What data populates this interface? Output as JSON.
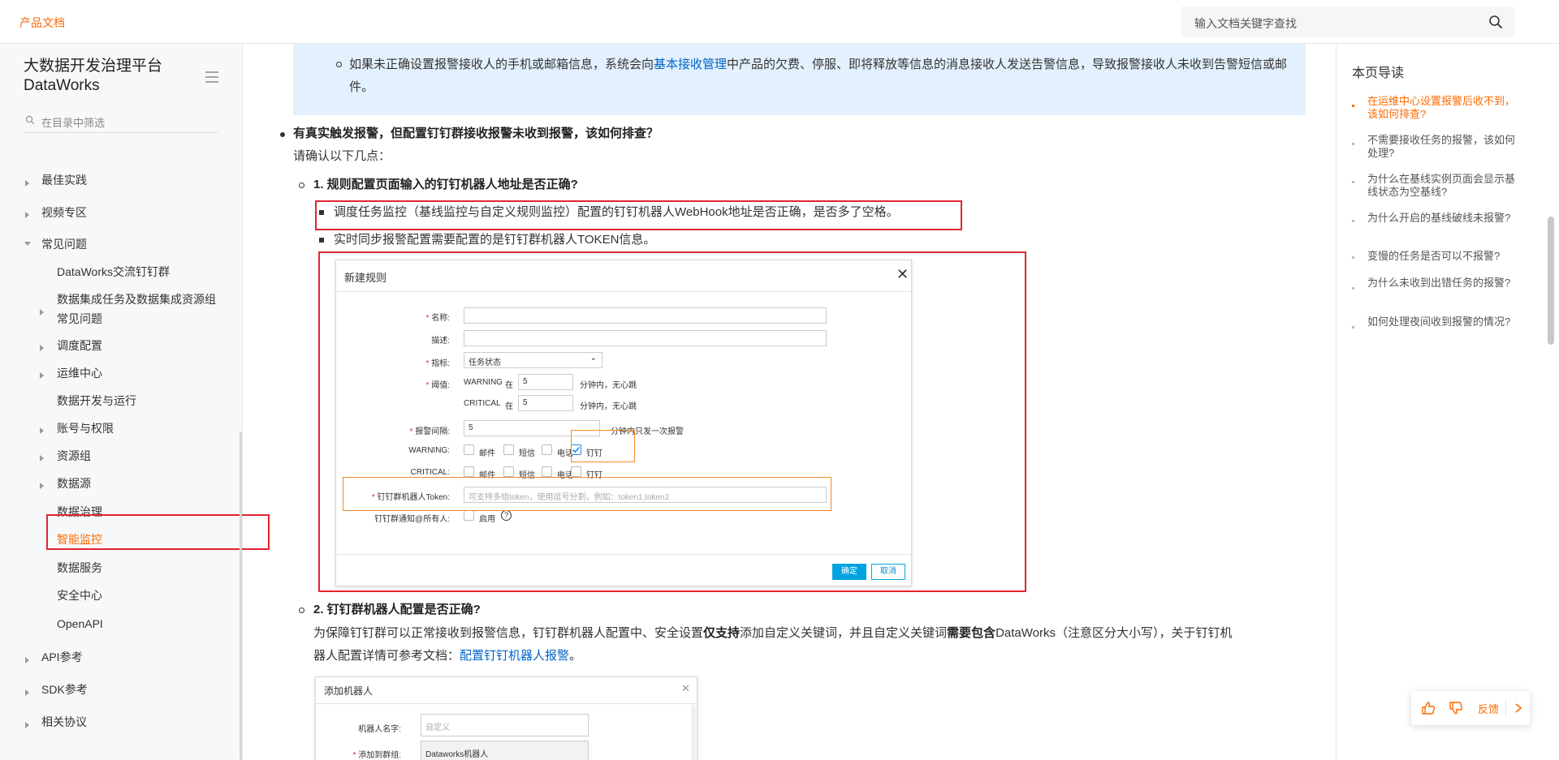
{
  "header": {
    "brand": "产品文档",
    "search_placeholder": "输入文档关键字查找"
  },
  "sidebar": {
    "title_line1": "大数据开发治理平台",
    "title_line2": "DataWorks",
    "filter_placeholder": "在目录中筛选",
    "items": [
      {
        "label": "最佳实践"
      },
      {
        "label": "视频专区"
      },
      {
        "label": "常见问题"
      },
      {
        "label": "DataWorks交流钉钉群"
      },
      {
        "label": "数据集成任务及数据集成资源组"
      },
      {
        "label": "常见问题"
      },
      {
        "label": "调度配置"
      },
      {
        "label": "运维中心"
      },
      {
        "label": "数据开发与运行"
      },
      {
        "label": "账号与权限"
      },
      {
        "label": "资源组"
      },
      {
        "label": "数据源"
      },
      {
        "label": "数据治理"
      },
      {
        "label": "智能监控"
      },
      {
        "label": "数据服务"
      },
      {
        "label": "安全中心"
      },
      {
        "label": "OpenAPI"
      },
      {
        "label": "API参考"
      },
      {
        "label": "SDK参考"
      },
      {
        "label": "相关协议"
      }
    ]
  },
  "content": {
    "info_text_pre": "如果未正确设置报警接收人的手机或邮箱信息，系统会向",
    "info_link": "基本接收管理",
    "info_text_post": "中产品的欠费、停服、即将释放等信息的消息接收人发送告警信息，导致报警接收人未收到告警短信或邮件。",
    "q_heading": "有真实触发报警，但配置钉钉群接收报警未收到报警，该如何排查？",
    "q_intro": "请确认以下几点：",
    "item1_heading": "1. 规则配置页面输入的钉钉机器人地址是否正确?",
    "item1_point1": "调度任务监控（基线监控与自定义规则监控）配置的钉钉机器人WebHook地址是否正确，是否多了空格。",
    "item1_point2": "实时同步报警配置需要配置的是钉钉群机器人TOKEN信息。",
    "item2_heading": "2. 钉钉群机器人配置是否正确?",
    "item2_text_a": "为保障钉钉群可以正常接收到报警信息，钉钉群机器人配置中、安全设置",
    "item2_bold1": "仅支持",
    "item2_text_b": "添加自定义关键词，并且自定义关键词",
    "item2_bold2": "需要包含",
    "item2_text_c": "DataWorks（注意区分大小写），关于钉钉机",
    "item2_text_d": "器人配置详情可参考文档：",
    "item2_link": "配置钉钉机器人报警",
    "item2_text_e": "。"
  },
  "dialog1": {
    "title": "新建规则",
    "close": "✕",
    "label_name": "名称:",
    "label_desc": "描述:",
    "label_metric": "指标:",
    "metric_value": "任务状态",
    "label_threshold": "阈值:",
    "warning": "WARNING",
    "critical": "CRITICAL",
    "at": "在",
    "threshold_value": "5",
    "threshold_suffix": "分钟内，无心跳",
    "label_interval": "报警间隔:",
    "interval_value": "5",
    "interval_suffix": "分钟内只发一次报警",
    "label_warning": "WARNING:",
    "label_critical": "CRITICAL:",
    "opt_mail": "邮件",
    "opt_sms": "短信",
    "opt_phone": "电话",
    "opt_ding": "钉钉",
    "label_token": "钉钉群机器人Token:",
    "token_placeholder": "可支持多组token，使用逗号分割，例如：token1,token2",
    "label_atall": "钉钉群通知@所有人:",
    "opt_enable": "启用",
    "help": "?",
    "btn_ok": "确定",
    "btn_cancel": "取消"
  },
  "dialog2": {
    "title": "添加机器人",
    "close": "✕",
    "label_robot_name": "机器人名字:",
    "robot_name_ph": "自定义",
    "label_group": "添加到群组:",
    "group_value": "Dataworks机器人"
  },
  "toc": {
    "title": "本页导读",
    "items": [
      {
        "label": "在运维中心设置报警后收不到，该如何排查?"
      },
      {
        "label": "不需要接收任务的报警，该如何处理?"
      },
      {
        "label": "为什么在基线实例页面会显示基线状态为空基线?"
      },
      {
        "label": "为什么开启的基线破线未报警?"
      },
      {
        "label": "变慢的任务是否可以不报警?"
      },
      {
        "label": "为什么未收到出错任务的报警?"
      },
      {
        "label": "如何处理夜间收到报警的情况?"
      }
    ]
  },
  "feedback": {
    "label": "反馈"
  },
  "colors": {
    "accent": "#ff6a00",
    "link": "#0064c8",
    "highlight_red": "#e0262e",
    "highlight_orange": "#f08a24",
    "info_bg": "#e3f0fd"
  }
}
